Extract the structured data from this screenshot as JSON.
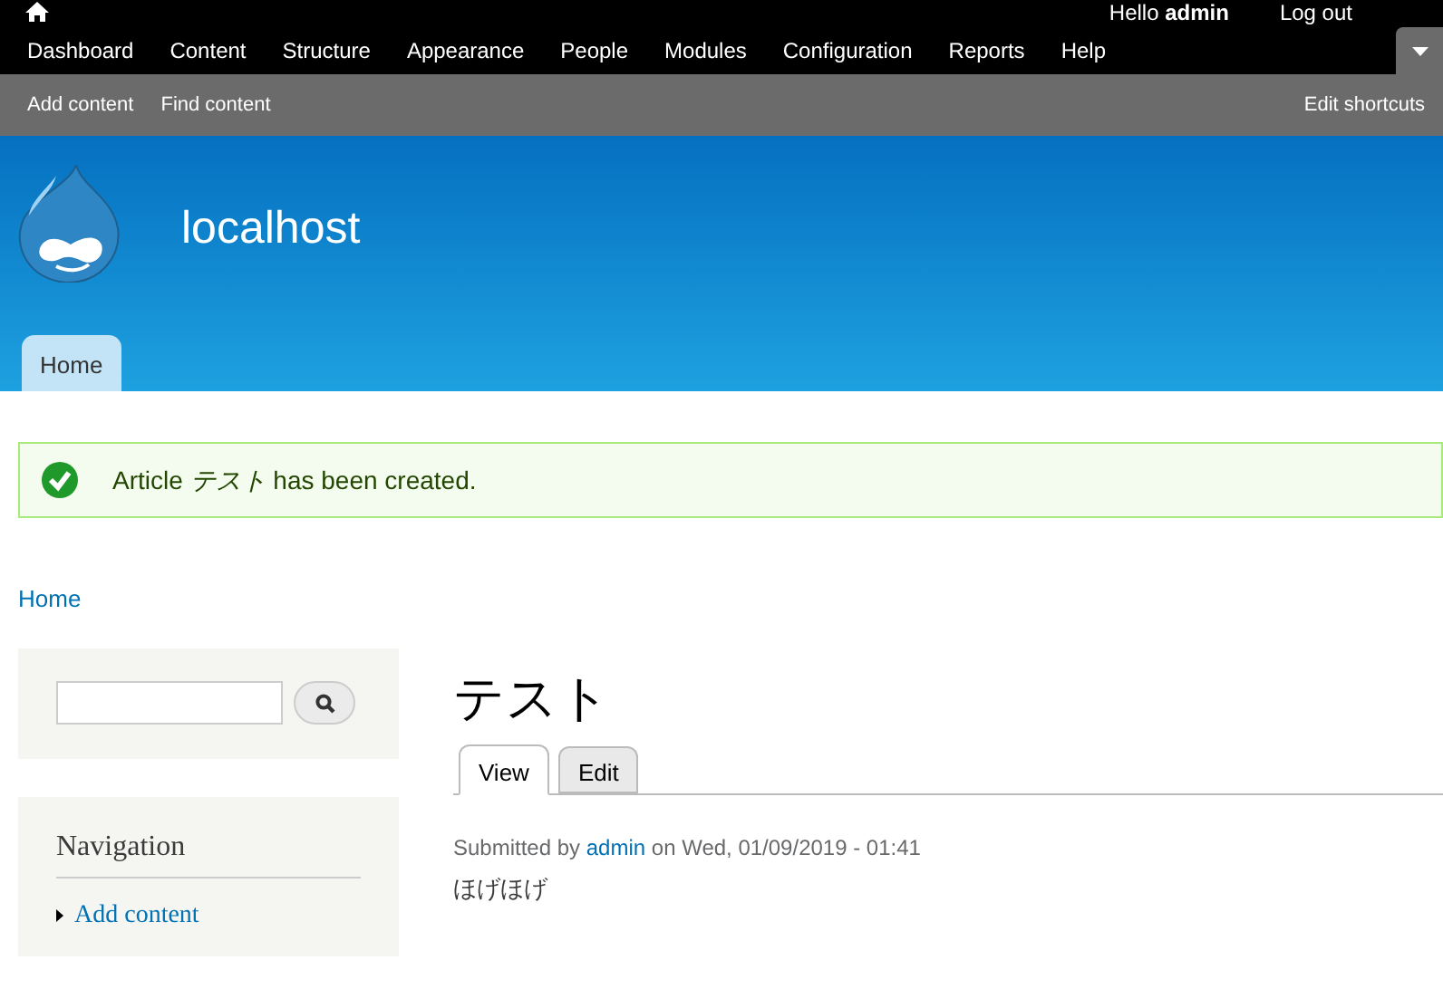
{
  "toolbar": {
    "user_greeting": "Hello **admin**",
    "logout": "Log out",
    "menu": [
      {
        "label": "Dashboard"
      },
      {
        "label": "Content"
      },
      {
        "label": "Structure"
      },
      {
        "label": "Appearance"
      },
      {
        "label": "People"
      },
      {
        "label": "Modules"
      },
      {
        "label": "Configuration"
      },
      {
        "label": "Reports"
      },
      {
        "label": "Help"
      }
    ],
    "shortcuts": [
      "Add content",
      "Find content"
    ],
    "edit_shortcuts": "Edit shortcuts"
  },
  "header": {
    "site_name": "localhost",
    "tabs": [
      {
        "label": "Home",
        "selected": true
      }
    ]
  },
  "message": {
    "kind": "status",
    "text": "Article *テスト* has been created."
  },
  "breadcrumb": "Home",
  "sidebar": {
    "navigation": {
      "title": "Navigation",
      "items": [
        "Add content"
      ]
    }
  },
  "node": {
    "title": "テスト",
    "tabs": [
      {
        "label": "View",
        "selected": true
      },
      {
        "label": "Edit",
        "selected": false
      }
    ],
    "submitted": {
      "prefix": "Submitted by",
      "author": "admin",
      "suffix": "on Wed, 01/09/2019 - 01:41"
    },
    "body": "ほげほげ"
  }
}
